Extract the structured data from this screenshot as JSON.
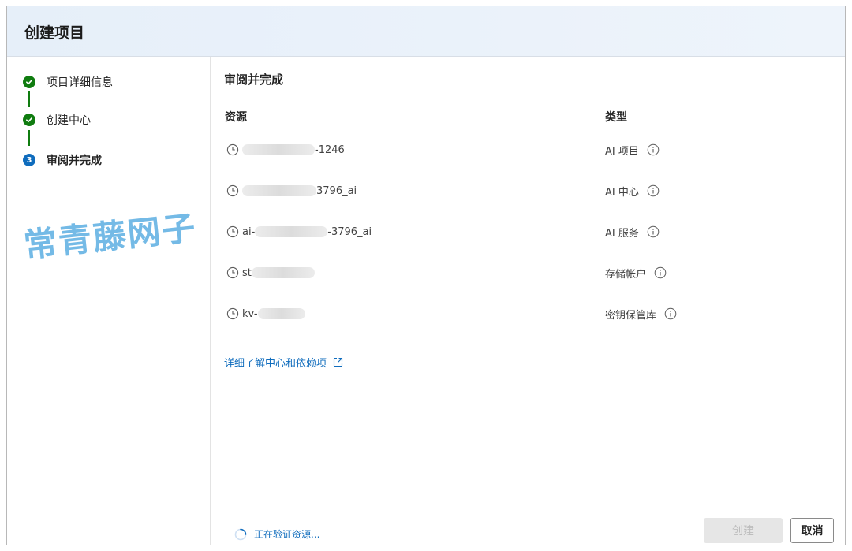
{
  "dialog": {
    "title": "创建项目"
  },
  "steps": [
    {
      "label": "项目详细信息",
      "state": "done"
    },
    {
      "label": "创建中心",
      "state": "done"
    },
    {
      "label": "审阅并完成",
      "state": "active",
      "number": "3"
    }
  ],
  "review": {
    "section_title": "审阅并完成",
    "column_resource": "资源",
    "column_type": "类型",
    "rows": [
      {
        "prefix": "",
        "suffix": "-1246",
        "type": "AI 项目"
      },
      {
        "prefix": "",
        "suffix": "3796_ai",
        "type": "AI 中心"
      },
      {
        "prefix": "ai-",
        "suffix": "-3796_ai",
        "type": "AI 服务"
      },
      {
        "prefix": "st",
        "suffix": "",
        "type": "存储帐户"
      },
      {
        "prefix": "kv-",
        "suffix": "",
        "type": "密钥保管库"
      }
    ],
    "learn_more": "详细了解中心和依赖项"
  },
  "status": {
    "text": "正在验证资源..."
  },
  "buttons": {
    "create": "创建",
    "cancel": "取消"
  },
  "watermark": "常青藤网子",
  "colors": {
    "accent": "#0f6cbd",
    "success": "#107c10",
    "header_bg": "#e6eff9"
  }
}
